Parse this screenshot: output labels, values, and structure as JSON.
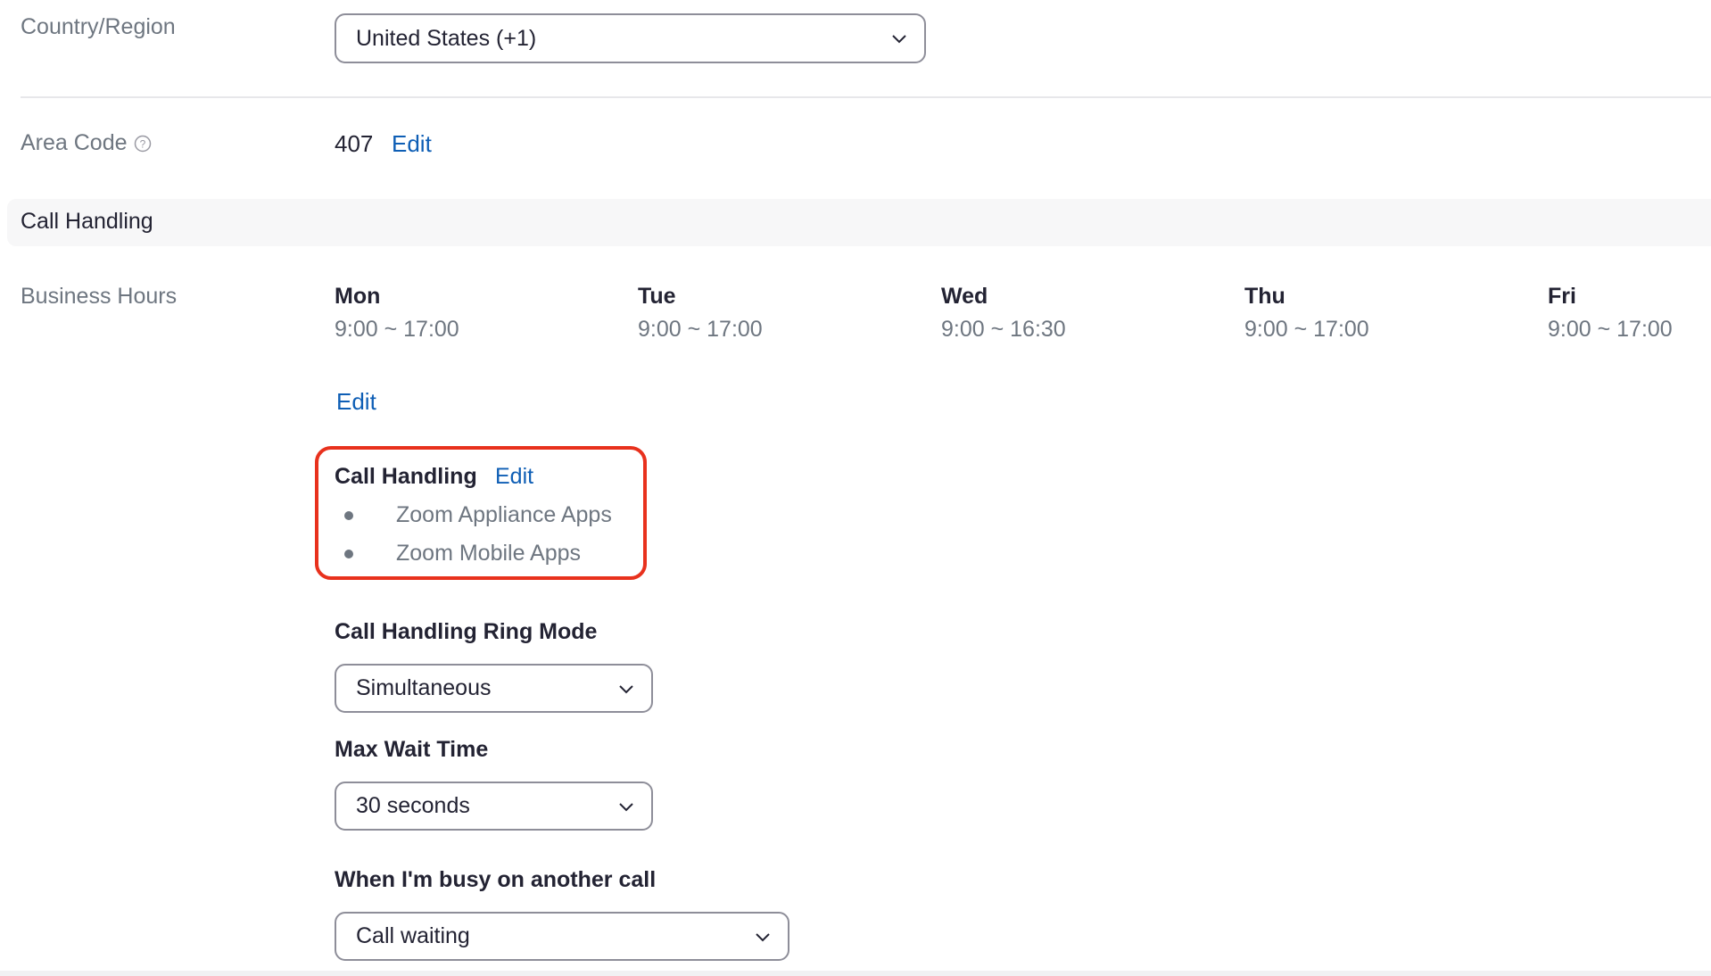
{
  "country_region": {
    "label": "Country/Region",
    "selected": "United States (+1)"
  },
  "area_code": {
    "label": "Area Code",
    "value": "407",
    "edit_label": "Edit",
    "help_icon": "question-circle-icon"
  },
  "section_header": "Call Handling",
  "business_hours": {
    "label": "Business Hours",
    "days": [
      {
        "day": "Mon",
        "hours": "9:00 ~ 17:00"
      },
      {
        "day": "Tue",
        "hours": "9:00 ~ 17:00"
      },
      {
        "day": "Wed",
        "hours": "9:00 ~ 16:30"
      },
      {
        "day": "Thu",
        "hours": "9:00 ~ 17:00"
      },
      {
        "day": "Fri",
        "hours": "9:00 ~ 17:00"
      }
    ],
    "edit_label": "Edit"
  },
  "call_handling": {
    "title": "Call Handling",
    "edit_label": "Edit",
    "items": [
      "Zoom Appliance Apps",
      "Zoom Mobile Apps"
    ],
    "highlight_color": "#e8311d"
  },
  "ring_mode": {
    "label": "Call Handling Ring Mode",
    "selected": "Simultaneous"
  },
  "max_wait_time": {
    "label": "Max Wait Time",
    "selected": "30 seconds"
  },
  "busy_behavior": {
    "label": "When I'm busy on another call",
    "selected": "Call waiting"
  },
  "colors": {
    "link": "#0e5eb5",
    "text": "#232333",
    "muted": "#6e7680"
  }
}
